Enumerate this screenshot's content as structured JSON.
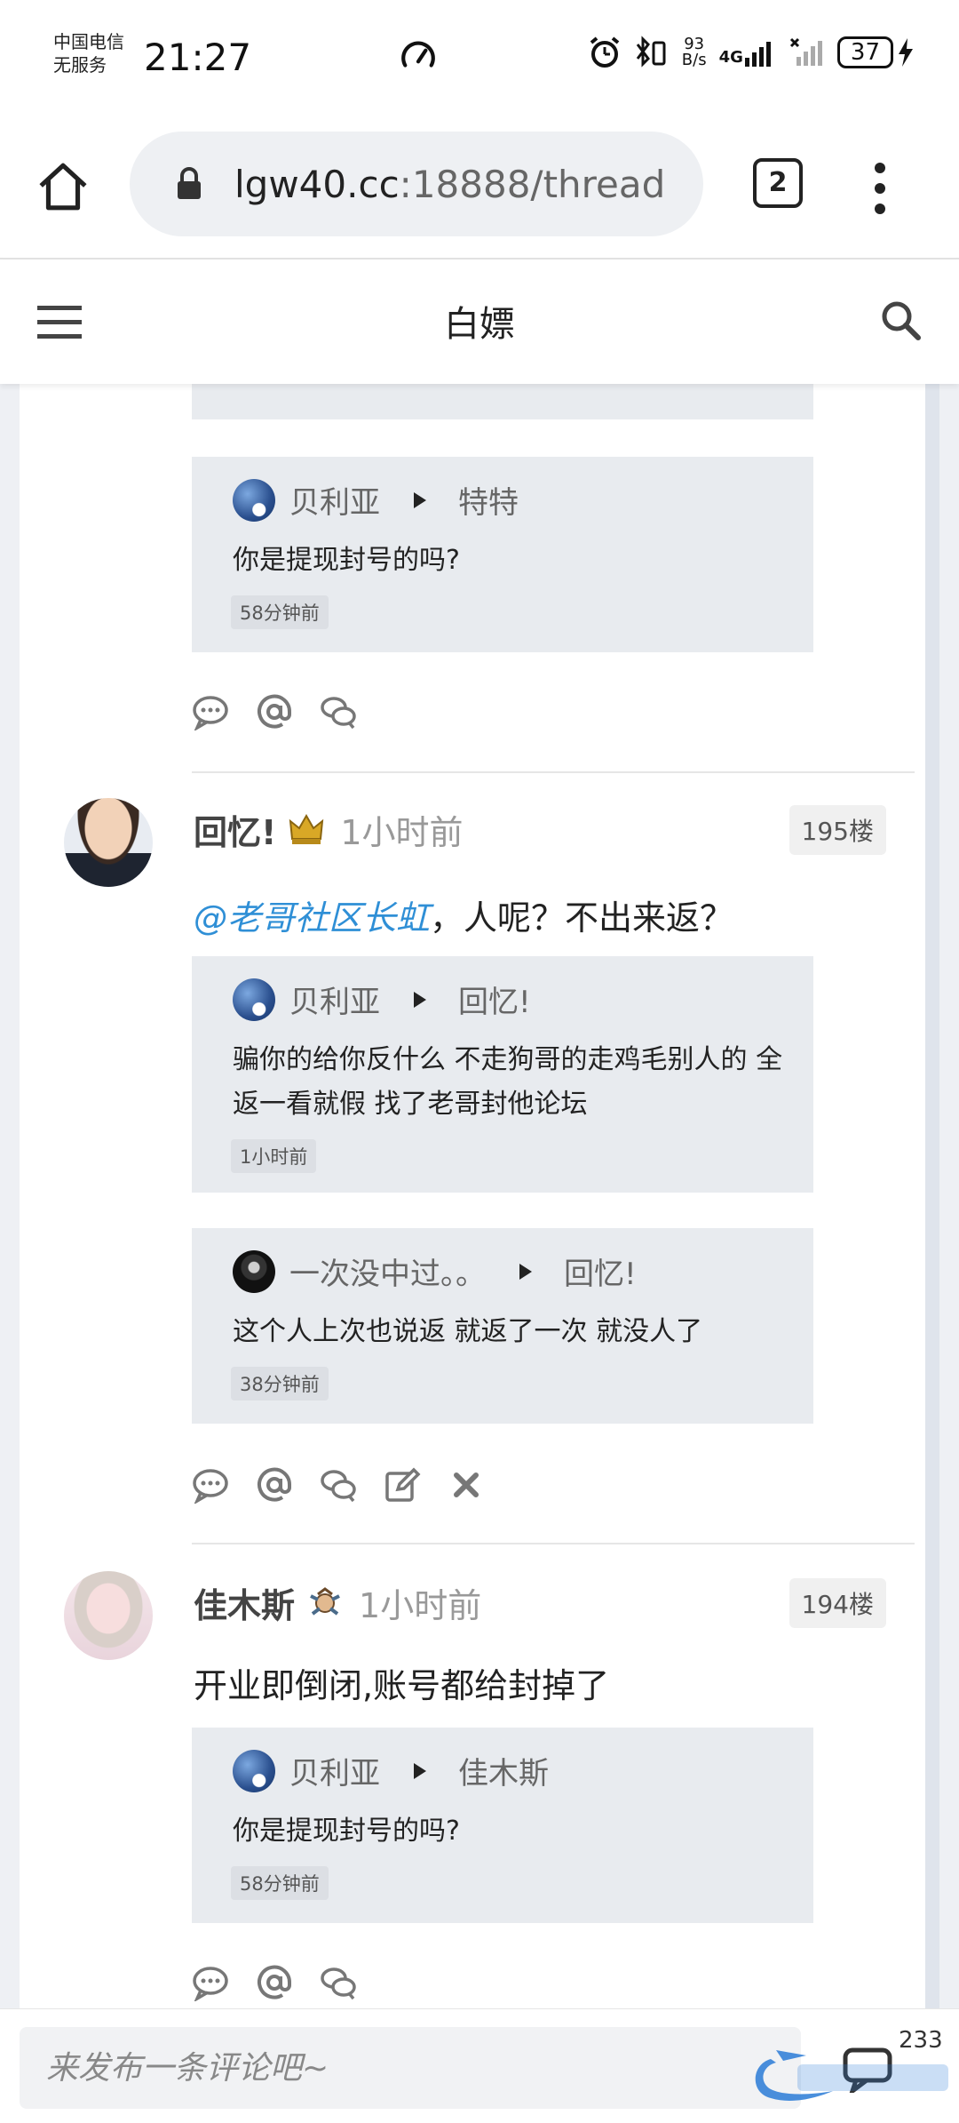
{
  "status_bar": {
    "carrier_line1": "中国电信",
    "carrier_line2": "无服务",
    "time": "21:27",
    "net_speed_value": "93",
    "net_speed_unit": "B/s",
    "network_type": "4G",
    "battery_level": "37"
  },
  "browser": {
    "url_host": "lgw40.cc",
    "url_rest": ":18888/thread",
    "tab_count": "2"
  },
  "app_bar": {
    "title": "白嫖"
  },
  "posts": [
    {
      "replies": [
        {
          "author": "贝利亚",
          "target": "特特",
          "text": "你是提现封号的吗?",
          "time": "58分钟前"
        }
      ]
    },
    {
      "author": "回忆!",
      "time": "1小时前",
      "floor": "195楼",
      "mention": "@老哥社区长虹",
      "body": "，人呢？不出来返？",
      "replies": [
        {
          "author": "贝利亚",
          "target": "回忆!",
          "text_line1": "骗你的给你反什么 不走狗哥的走鸡毛别人的 全",
          "text_line2": "返一看就假 找了老哥封他论坛",
          "time": "1小时前"
        },
        {
          "author": "一次没中过。。",
          "target": "回忆!",
          "text": "这个人上次也说返 就返了一次 就没人了",
          "time": "38分钟前"
        }
      ]
    },
    {
      "author": "佳木斯",
      "time": "1小时前",
      "floor": "194楼",
      "body": "开业即倒闭,账号都给封掉了",
      "replies": [
        {
          "author": "贝利亚",
          "target": "佳木斯",
          "text": "你是提现封号的吗?",
          "time": "58分钟前"
        }
      ]
    }
  ],
  "comment_bar": {
    "placeholder": "来发布一条评论吧~",
    "comment_count": "233"
  },
  "colors": {
    "mention": "#2f8fd6",
    "reply_bg": "#e8ebef",
    "page_bg": "#eef0f4"
  }
}
